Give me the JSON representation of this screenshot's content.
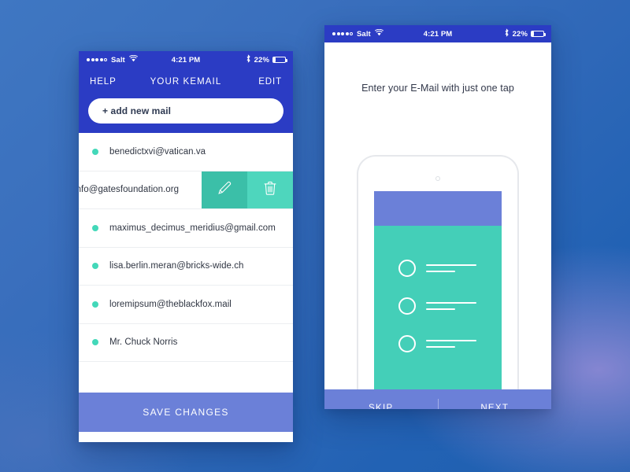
{
  "background": {
    "accent_blue": "#2f68b8",
    "glow_purple": "#968cd7"
  },
  "colors": {
    "royal_blue": "#2b3cc4",
    "periwinkle": "#6b80d8",
    "teal": "#44cfb8",
    "teal_dark": "#3bbfa8",
    "teal_dot": "#43d8b9"
  },
  "left_phone": {
    "status_bar": {
      "carrier": "Salt",
      "signal_filled": 4,
      "signal_empty": 1,
      "wifi_icon": "wifi-icon",
      "time": "4:21 PM",
      "bluetooth_icon": "bluetooth-icon",
      "battery_percent": "22%",
      "battery_icon": "battery-icon",
      "battery_level": 22
    },
    "navbar": {
      "left_action": "HELP",
      "title": "YOUR KEMAIL",
      "right_action": "EDIT"
    },
    "add_field": {
      "label": "+ add new mail"
    },
    "list": [
      {
        "email": "benedictxvi@vatican.va",
        "swiped": false
      },
      {
        "email": "info@gatesfoundation.org",
        "swiped": true,
        "actions": [
          {
            "name": "edit",
            "icon": "pencil-icon"
          },
          {
            "name": "delete",
            "icon": "trash-icon"
          }
        ]
      },
      {
        "email": "maximus_decimus_meridius@gmail.com",
        "swiped": false
      },
      {
        "email": "lisa.berlin.meran@bricks-wide.ch",
        "swiped": false
      },
      {
        "email": "loremipsum@theblackfox.mail",
        "swiped": false
      },
      {
        "email": "Mr. Chuck Norris",
        "swiped": false
      }
    ],
    "save_button": {
      "label": "SAVE CHANGES"
    }
  },
  "right_phone": {
    "status_bar": {
      "carrier": "Salt",
      "signal_filled": 4,
      "signal_empty": 1,
      "wifi_icon": "wifi-icon",
      "time": "4:21 PM",
      "bluetooth_icon": "bluetooth-icon",
      "battery_percent": "22%",
      "battery_icon": "battery-icon",
      "battery_level": 22
    },
    "caption": "Enter your E-Mail with just one tap",
    "illustration": {
      "name": "phone-mockup-illustration",
      "list_item_count": 3
    },
    "footer": {
      "skip_label": "SKIP",
      "next_label": "NEXT"
    }
  }
}
